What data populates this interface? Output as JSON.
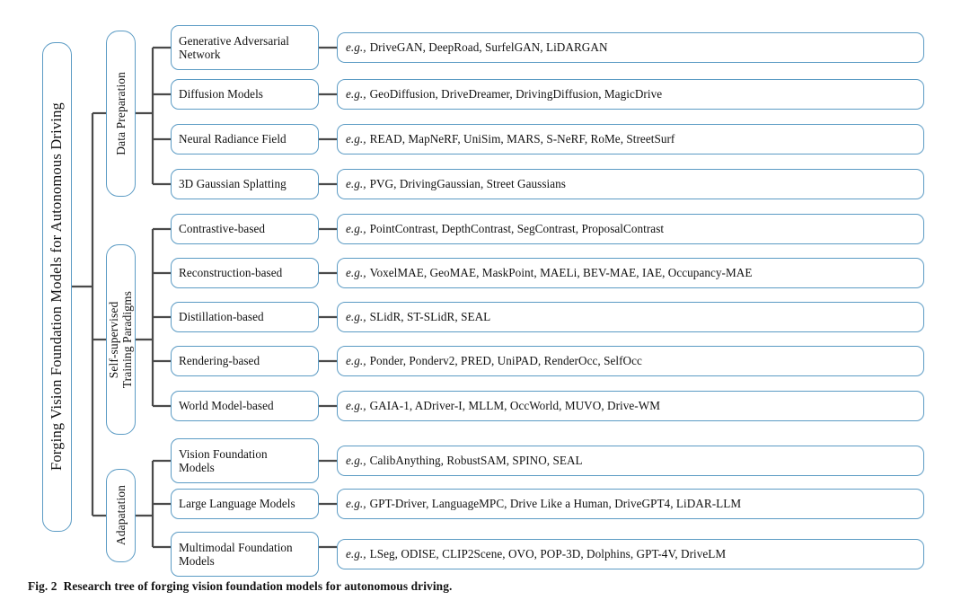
{
  "figure": {
    "caption_number": "Fig. 2",
    "caption_text": "Research tree of forging vision foundation models for autonomous driving.",
    "root_label": "Forging Vision Foundation Models for Autonomous Driving",
    "accent_color": "#5b9bc4",
    "connector_color": "#4a4a4a",
    "eg_prefix": "e.g.,"
  },
  "tree": {
    "categories": [
      {
        "label": "Data Preparation",
        "methods": [
          {
            "label": "Generative Adversarial\nNetwork",
            "examples": "DriveGAN, DeepRoad, SurfelGAN, LiDARGAN"
          },
          {
            "label": "Diffusion Models",
            "examples": "GeoDiffusion, DriveDreamer, DrivingDiffusion, MagicDrive"
          },
          {
            "label": "Neural Radiance Field",
            "examples": "READ, MapNeRF, UniSim, MARS, S-NeRF, RoMe, StreetSurf"
          },
          {
            "label": "3D Gaussian Splatting",
            "examples": "PVG, DrivingGaussian, Street Gaussians"
          }
        ]
      },
      {
        "label": "Self-supervised\nTraining Paradigms",
        "methods": [
          {
            "label": "Contrastive-based",
            "examples": "PointContrast, DepthContrast, SegContrast, ProposalContrast"
          },
          {
            "label": "Reconstruction-based",
            "examples": "VoxelMAE, GeoMAE, MaskPoint, MAELi, BEV-MAE, IAE, Occupancy-MAE"
          },
          {
            "label": "Distillation-based",
            "examples": "SLidR, ST-SLidR, SEAL"
          },
          {
            "label": "Rendering-based",
            "examples": "Ponder, Ponderv2, PRED, UniPAD, RenderOcc, SelfOcc"
          },
          {
            "label": "World Model-based",
            "examples": "GAIA-1, ADriver-I, MLLM, OccWorld, MUVO, Drive-WM"
          }
        ]
      },
      {
        "label": "Adapatation",
        "methods": [
          {
            "label": "Vision Foundation\nModels",
            "examples": "CalibAnything, RobustSAM, SPINO, SEAL"
          },
          {
            "label": "Large Language Models",
            "examples": "GPT-Driver, LanguageMPC, Drive Like a Human, DriveGPT4, LiDAR-LLM"
          },
          {
            "label": "Multimodal Foundation\nModels",
            "examples": "LSeg, ODISE, CLIP2Scene, OVO, POP-3D, Dolphins, GPT-4V, DriveLM"
          }
        ]
      }
    ]
  }
}
